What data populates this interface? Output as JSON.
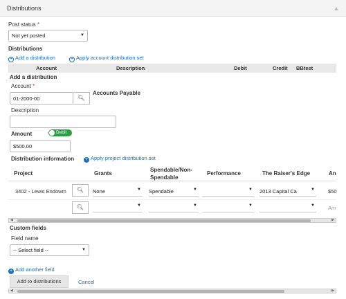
{
  "panel": {
    "title": "Distributions"
  },
  "post_status": {
    "label": "Post status",
    "required": "*",
    "value": "Not yet posted"
  },
  "distributions": {
    "heading": "Distributions",
    "add_link": "Add a distribution",
    "apply_link": "Apply account distribution set",
    "columns": [
      "Account",
      "Description",
      "Debit",
      "Credit",
      "BBtest"
    ]
  },
  "add_distribution": {
    "heading": "Add a distribution",
    "account_label": "Account",
    "account_required": "*",
    "account_value": "01-2000-00",
    "account_name": "Accounts Payable",
    "description_label": "Description",
    "description_value": "",
    "amount_label": "Amount",
    "toggle_label": "Debit",
    "amount_value": "$500.00"
  },
  "distribution_info": {
    "heading": "Distribution information",
    "apply_link": "Apply project distribution set",
    "columns": [
      "Project",
      "Grants",
      "Spendable/Non-Spendable",
      "Performance",
      "The Raiser's Edge",
      "An"
    ],
    "row1": {
      "project": "3402 - Lewis Endowm",
      "grants": "None",
      "spendable": "Spendable",
      "performance": "",
      "raisers_edge": "2013 Capital Ca",
      "amount": "$50"
    },
    "row2": {
      "amount_placeholder": "Am"
    }
  },
  "custom_fields": {
    "heading": "Custom fields",
    "field_name_label": "Field name",
    "select_value": "-- Select field --",
    "add_link": "Add another field"
  },
  "actions": {
    "add_button": "Add to distributions",
    "cancel": "Cancel"
  },
  "colors": {
    "link": "#1a6fb8",
    "toggle": "#2f9e3f",
    "required": "#d9342b"
  },
  "icons": [
    "chevron-up-icon",
    "plus-circle-icon",
    "search-icon",
    "caret-down-icon"
  ]
}
